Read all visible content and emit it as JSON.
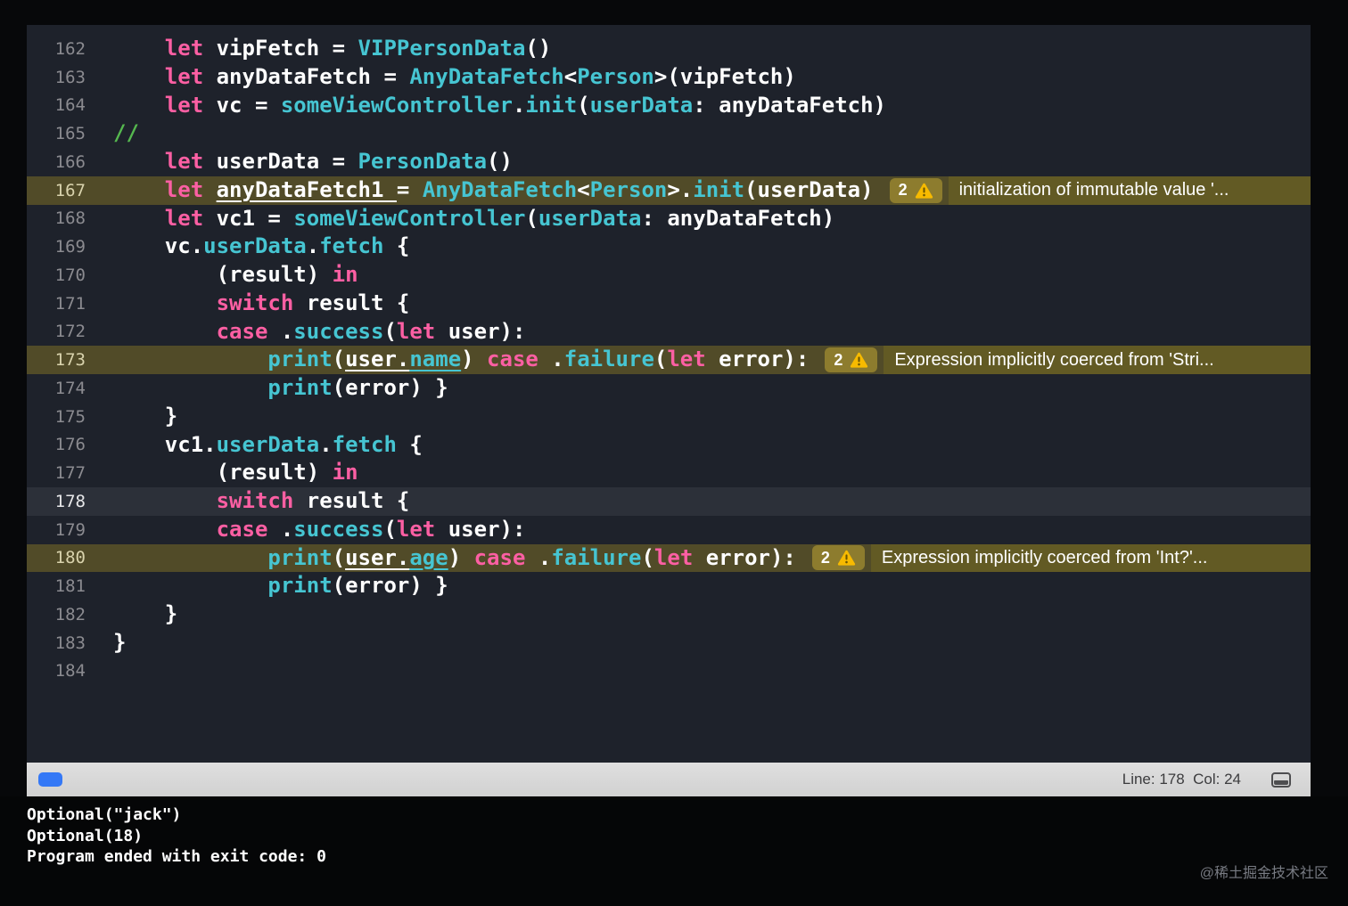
{
  "colors": {
    "editor_bg": "#1e222b",
    "code_text": "#ffffff",
    "keyword": "#fc5fa3",
    "type": "#46c5d2",
    "comment": "#55b84f",
    "warning_row": "#514b28",
    "warning_badge": "#8d7c2e",
    "warning_msg_bg": "#625a24",
    "warning_triangle": "#f7ba00",
    "current_line": "#2c3039",
    "status_blue": "#3478f6"
  },
  "icons": {
    "warning": "warning-triangle-icon",
    "console_toggle": "console-pane-icon"
  },
  "editor": {
    "lines": [
      {
        "num": "162",
        "ind": 4,
        "tokens": [
          [
            "let",
            "k"
          ],
          [
            " vipFetch = "
          ],
          [
            "VIPPersonData",
            "t"
          ],
          [
            "()"
          ]
        ]
      },
      {
        "num": "163",
        "ind": 4,
        "tokens": [
          [
            "let",
            "k"
          ],
          [
            " anyDataFetch = "
          ],
          [
            "AnyDataFetch",
            "t"
          ],
          [
            "<"
          ],
          [
            "Person",
            "t"
          ],
          [
            ">(vipFetch)"
          ]
        ]
      },
      {
        "num": "164",
        "ind": 4,
        "tokens": [
          [
            "let",
            "k"
          ],
          [
            " vc = "
          ],
          [
            "someViewController",
            "t"
          ],
          [
            "."
          ],
          [
            "init",
            "t"
          ],
          [
            "("
          ],
          [
            "userData",
            "t"
          ],
          [
            ": anyDataFetch)"
          ]
        ]
      },
      {
        "num": "165",
        "ind": 0,
        "tokens": [
          [
            "//",
            "c"
          ]
        ]
      },
      {
        "num": "166",
        "ind": 4,
        "tokens": [
          [
            "let",
            "k"
          ],
          [
            " userData = "
          ],
          [
            "PersonData",
            "t"
          ],
          [
            "()"
          ]
        ]
      },
      {
        "num": "167",
        "ind": 4,
        "hl": "warn",
        "tokens": [
          [
            "let",
            "k"
          ],
          [
            " "
          ],
          [
            "anyDataFetch1 ",
            "p",
            "u"
          ],
          [
            "= "
          ],
          [
            "AnyDataFetch",
            "t"
          ],
          [
            "<"
          ],
          [
            "Person",
            "t"
          ],
          [
            ">."
          ],
          [
            "init",
            "t"
          ],
          [
            "(userData)"
          ]
        ],
        "warn": {
          "count": "2",
          "message": "initialization of immutable value '..."
        }
      },
      {
        "num": "168",
        "ind": 4,
        "tokens": [
          [
            "let",
            "k"
          ],
          [
            " vc1 = "
          ],
          [
            "someViewController",
            "t"
          ],
          [
            "("
          ],
          [
            "userData",
            "t"
          ],
          [
            ": anyDataFetch)"
          ]
        ]
      },
      {
        "num": "169",
        "ind": 4,
        "tokens": [
          [
            "vc."
          ],
          [
            "userData",
            "t"
          ],
          [
            "."
          ],
          [
            "fetch",
            "t"
          ],
          [
            " {"
          ]
        ]
      },
      {
        "num": "170",
        "ind": 8,
        "tokens": [
          [
            "(result) "
          ],
          [
            "in",
            "k"
          ]
        ]
      },
      {
        "num": "171",
        "ind": 8,
        "tokens": [
          [
            "switch",
            "k"
          ],
          [
            " result {"
          ]
        ]
      },
      {
        "num": "172",
        "ind": 8,
        "tokens": [
          [
            "case",
            "k"
          ],
          [
            " ."
          ],
          [
            "success",
            "t"
          ],
          [
            "("
          ],
          [
            "let",
            "k"
          ],
          [
            " user):"
          ]
        ]
      },
      {
        "num": "173",
        "ind": 12,
        "hl": "warn",
        "tokens": [
          [
            "print",
            "t"
          ],
          [
            "("
          ],
          [
            "user.",
            "p",
            "u"
          ],
          [
            "name",
            "t",
            "u"
          ],
          [
            ") "
          ],
          [
            "case",
            "k"
          ],
          [
            " ."
          ],
          [
            "failure",
            "t"
          ],
          [
            "("
          ],
          [
            "let",
            "k"
          ],
          [
            " error):"
          ]
        ],
        "warn": {
          "count": "2",
          "message": "Expression implicitly coerced from 'Stri..."
        }
      },
      {
        "num": "174",
        "ind": 12,
        "tokens": [
          [
            "print",
            "t"
          ],
          [
            "(error) }"
          ]
        ]
      },
      {
        "num": "175",
        "ind": 4,
        "tokens": [
          [
            "}"
          ]
        ]
      },
      {
        "num": "176",
        "ind": 4,
        "tokens": [
          [
            "vc1."
          ],
          [
            "userData",
            "t"
          ],
          [
            "."
          ],
          [
            "fetch",
            "t"
          ],
          [
            " {"
          ]
        ]
      },
      {
        "num": "177",
        "ind": 8,
        "tokens": [
          [
            "(result) "
          ],
          [
            "in",
            "k"
          ]
        ]
      },
      {
        "num": "178",
        "ind": 8,
        "hl": "cur",
        "tokens": [
          [
            "switch",
            "k"
          ],
          [
            " result {"
          ]
        ]
      },
      {
        "num": "179",
        "ind": 8,
        "tokens": [
          [
            "case",
            "k"
          ],
          [
            " ."
          ],
          [
            "success",
            "t"
          ],
          [
            "("
          ],
          [
            "let",
            "k"
          ],
          [
            " user):"
          ]
        ]
      },
      {
        "num": "180",
        "ind": 12,
        "hl": "warn",
        "tokens": [
          [
            "print",
            "t"
          ],
          [
            "("
          ],
          [
            "user.",
            "p",
            "u"
          ],
          [
            "age",
            "t",
            "u"
          ],
          [
            ") "
          ],
          [
            "case",
            "k"
          ],
          [
            " ."
          ],
          [
            "failure",
            "t"
          ],
          [
            "("
          ],
          [
            "let",
            "k"
          ],
          [
            " error):"
          ]
        ],
        "warn": {
          "count": "2",
          "message": "Expression implicitly coerced from 'Int?'..."
        }
      },
      {
        "num": "181",
        "ind": 12,
        "tokens": [
          [
            "print",
            "t"
          ],
          [
            "(error) }"
          ]
        ]
      },
      {
        "num": "182",
        "ind": 4,
        "tokens": [
          [
            "}"
          ]
        ]
      },
      {
        "num": "183",
        "ind": 0,
        "tokens": [
          [
            "}"
          ]
        ]
      },
      {
        "num": "184",
        "ind": 0,
        "tokens": []
      }
    ]
  },
  "status_bar": {
    "line_col": "Line: 178  Col: 24"
  },
  "console": {
    "lines": [
      "Optional(\"jack\")",
      "Optional(18)",
      "Program ended with exit code: 0"
    ]
  },
  "watermark": "@稀土掘金技术社区"
}
